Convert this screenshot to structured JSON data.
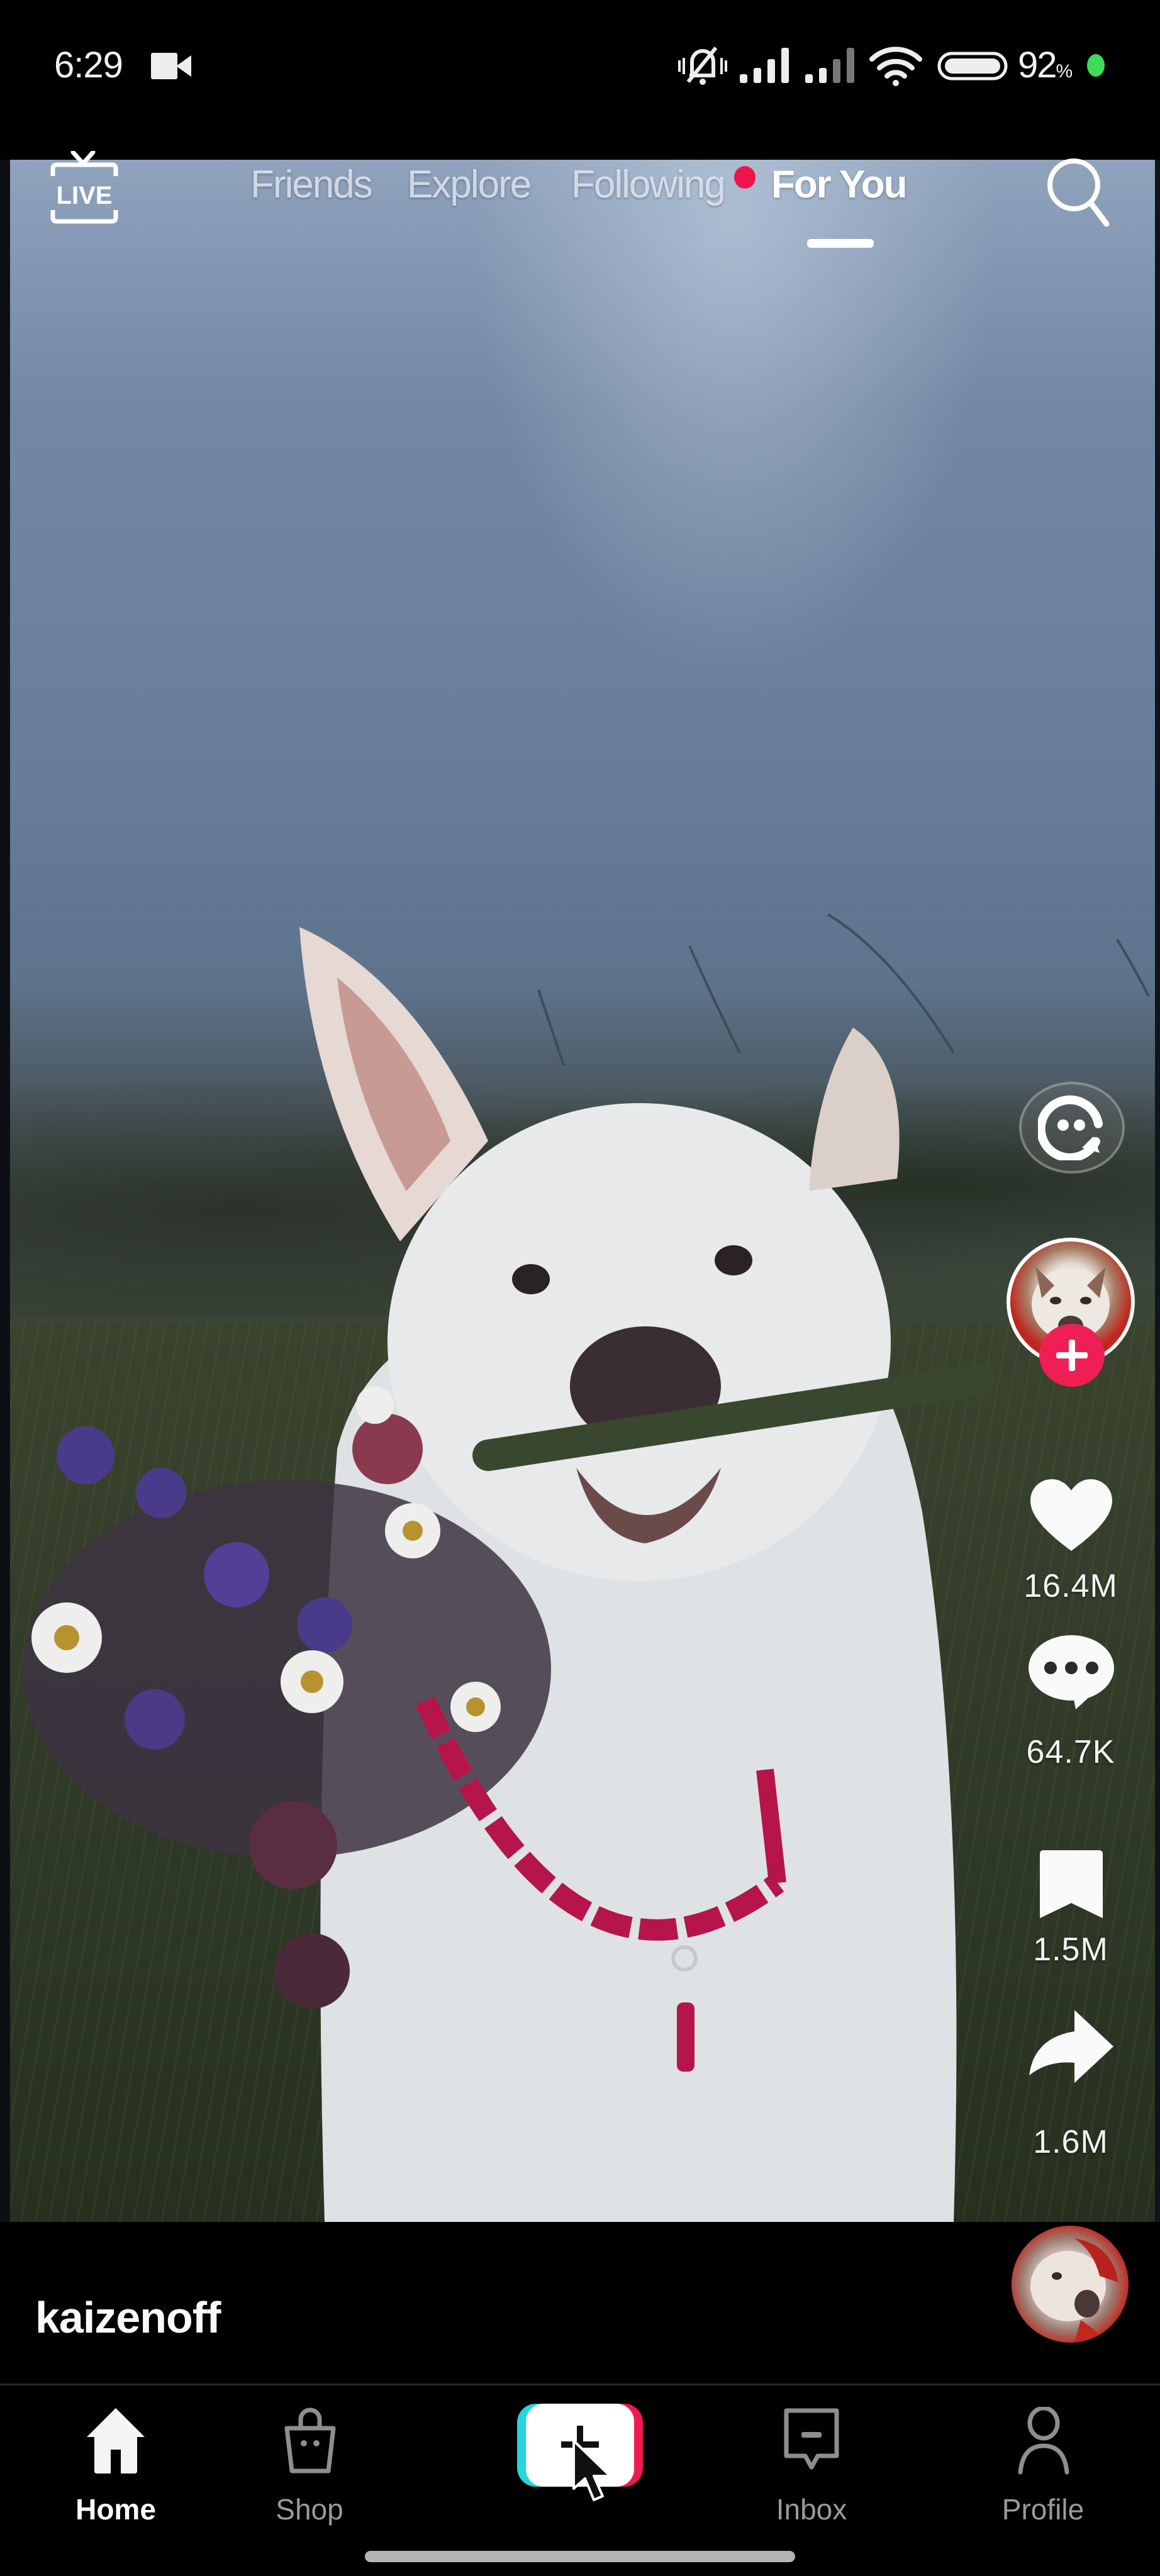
{
  "status_bar": {
    "time": "6:29",
    "left_icons": [
      "video-camera-icon"
    ],
    "right_icons": [
      "muted-bell-icon",
      "signal-icon",
      "signal-weak-icon",
      "wifi-icon",
      "battery-icon"
    ],
    "battery_percent": "92",
    "battery_percent_sign": "%",
    "indicator_color": "#3ddc5b"
  },
  "top_nav": {
    "live_label": "LIVE",
    "tabs": [
      {
        "label": "Friends",
        "active": false
      },
      {
        "label": "Explore",
        "active": false
      },
      {
        "label": "Following",
        "active": false,
        "badge": "dot"
      },
      {
        "label": "For You",
        "active": true
      }
    ],
    "badge_color": "#f0144c",
    "search_icon": "search-icon"
  },
  "video": {
    "description": "White dog holding a bouquet of wildflowers in its mouth, cloudy sky, grassy field"
  },
  "actions": {
    "ai_assistant_icon": "ai-chat-icon",
    "creator_avatar": "husky-avatar",
    "follow_icon": "plus-icon",
    "likes": "16.4M",
    "comments": "64.7K",
    "saves": "1.5M",
    "shares": "1.6M",
    "accent_color": "#ef1f56"
  },
  "info": {
    "username": "kaizenoff",
    "music_disc": "sound-disc"
  },
  "bottom_nav": {
    "items": [
      {
        "label": "Home",
        "icon": "home-icon",
        "active": true
      },
      {
        "label": "Shop",
        "icon": "shopping-bag-icon",
        "active": false
      },
      {
        "label": "",
        "icon": "create-plus-icon",
        "active": false
      },
      {
        "label": "Inbox",
        "icon": "inbox-icon",
        "active": false
      },
      {
        "label": "Profile",
        "icon": "profile-icon",
        "active": false
      }
    ],
    "create_colors": {
      "left": "#25d6dc",
      "right": "#f0194f"
    }
  }
}
